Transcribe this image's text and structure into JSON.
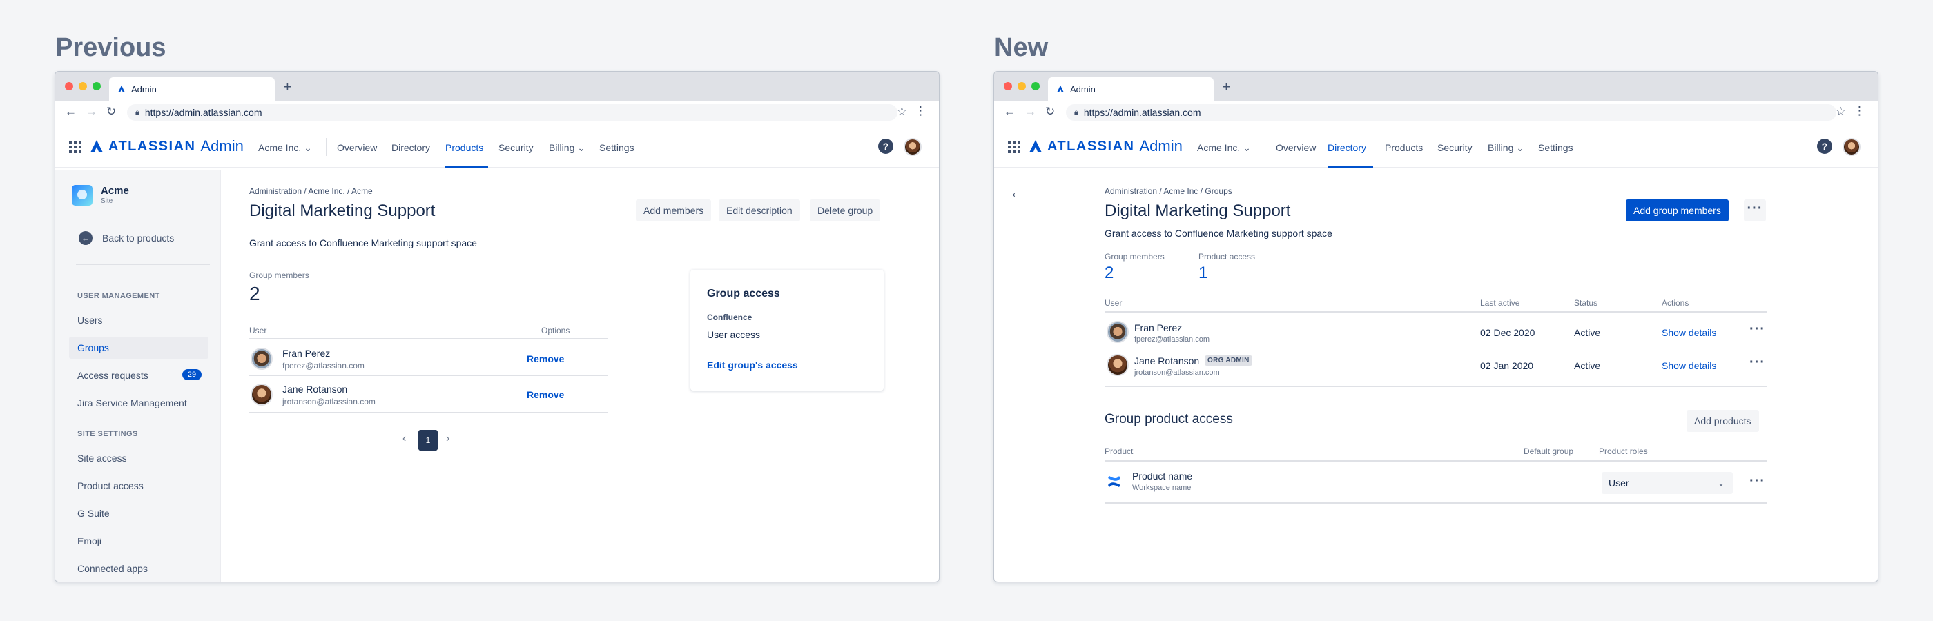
{
  "labels": {
    "previous": "Previous",
    "new": "New"
  },
  "browser": {
    "tab_title": "Admin",
    "new_tab": "+",
    "url": "https://admin.atlassian.com"
  },
  "appnav": {
    "brand": "ATLASSIAN",
    "product": "Admin",
    "org": "Acme Inc. ⌄",
    "items": [
      "Overview",
      "Directory",
      "Products",
      "Security",
      "Billing ⌄",
      "Settings"
    ],
    "old_active": "Products",
    "new_active": "Directory",
    "help": "?"
  },
  "old": {
    "sidebar": {
      "site_name": "Acme",
      "site_type": "Site",
      "back": "Back to products",
      "section_user_mgmt": "USER MANAGEMENT",
      "users": "Users",
      "groups": "Groups",
      "access_requests": "Access requests",
      "access_requests_count": "29",
      "jira_service": "Jira Service Management",
      "section_site": "SITE SETTINGS",
      "site_access": "Site access",
      "product_access": "Product access",
      "g_suite": "G Suite",
      "emoji": "Emoji",
      "connected_apps": "Connected apps"
    },
    "breadcrumb": "Administration / Acme Inc. / Acme",
    "title": "Digital Marketing Support",
    "description": "Grant access to Confluence Marketing support space",
    "buttons": {
      "add_members": "Add members",
      "edit_description": "Edit description",
      "delete_group": "Delete group"
    },
    "group_members_label": "Group members",
    "group_members_count": "2",
    "table": {
      "col_user": "User",
      "col_options": "Options",
      "rows": [
        {
          "name": "Fran Perez",
          "email": "fperez@atlassian.com",
          "action": "Remove"
        },
        {
          "name": "Jane Rotanson",
          "email": "jrotanson@atlassian.com",
          "action": "Remove"
        }
      ]
    },
    "pagination": {
      "prev": "‹",
      "current": "1",
      "next": "›"
    },
    "access_card": {
      "title": "Group access",
      "product": "Confluence",
      "value": "User access",
      "link": "Edit group's access"
    }
  },
  "new": {
    "breadcrumb": "Administration / Acme Inc / Groups",
    "title": "Digital Marketing Support",
    "description": "Grant access to Confluence Marketing support space",
    "add_group_members": "Add group members",
    "group_members_label": "Group members",
    "group_members_count": "2",
    "product_access_label": "Product access",
    "product_access_count": "1",
    "table": {
      "col_user": "User",
      "col_last_active": "Last active",
      "col_status": "Status",
      "col_actions": "Actions",
      "rows": [
        {
          "name": "Fran Perez",
          "email": "fperez@atlassian.com",
          "badge": "",
          "last_active": "02 Dec 2020",
          "status": "Active",
          "action": "Show details"
        },
        {
          "name": "Jane Rotanson",
          "email": "jrotanson@atlassian.com",
          "badge": "ORG ADMIN",
          "last_active": "02 Jan 2020",
          "status": "Active",
          "action": "Show details"
        }
      ]
    },
    "product_section": {
      "title": "Group product access",
      "add_products": "Add products",
      "col_product": "Product",
      "col_default_group": "Default group",
      "col_roles": "Product roles",
      "product_name": "Product name",
      "workspace_name": "Workspace name",
      "role": "User"
    }
  },
  "colors": {
    "brand": "#0052cc",
    "text": "#172b4d",
    "subtle": "#6b778c",
    "background": "#f4f5f7"
  }
}
